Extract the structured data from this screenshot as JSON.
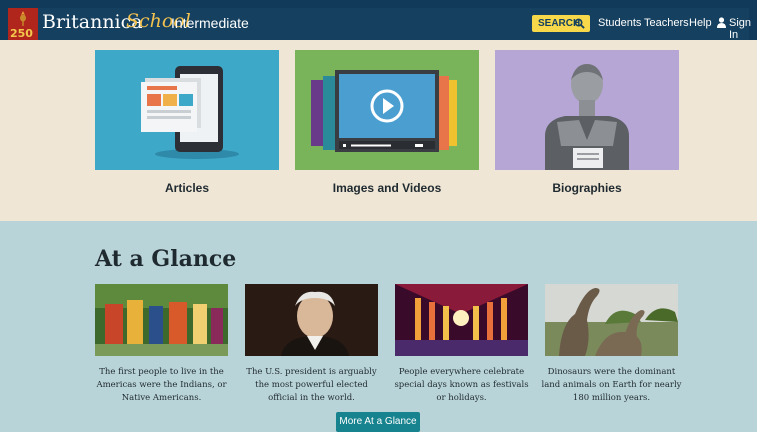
{
  "header": {
    "brand": "Britannica",
    "brand_school": "School",
    "level": "Intermediate",
    "anniversary": "250",
    "search_label": "SEARCH",
    "nav": [
      "Students",
      "Teachers",
      "Help",
      "Sign In"
    ]
  },
  "categories": [
    {
      "label": "Articles",
      "icon": "tablet-article-icon"
    },
    {
      "label": "Images and Videos",
      "icon": "video-player-icon"
    },
    {
      "label": "Biographies",
      "icon": "bust-statue-icon"
    }
  ],
  "glance": {
    "title": "At a Glance",
    "items": [
      {
        "caption": "The first people to live in the Americas were the Indians, or Native Americans."
      },
      {
        "caption": "The U.S. president is arguably the most powerful elected official in the world."
      },
      {
        "caption": "People everywhere celebrate special days known as festivals or holidays."
      },
      {
        "caption": "Dinosaurs were the dominant land animals on Earth for nearly 180 million years."
      }
    ],
    "more_label": "More At a Glance"
  },
  "colors": {
    "header_bg": "#10395a",
    "accent_yellow": "#f6d84a",
    "cat_band_bg": "#efe6d5",
    "glance_bg": "#b9d4d8",
    "button_teal": "#17838e"
  }
}
